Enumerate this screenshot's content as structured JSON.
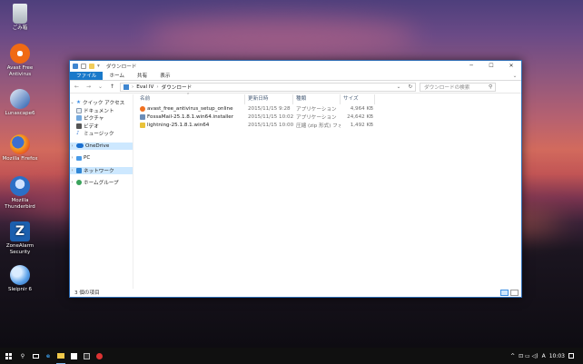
{
  "desktop": {
    "icons": [
      {
        "label": "ごみ箱",
        "icon": "recycle-bin-icon",
        "color": "#cfd6dd"
      },
      {
        "label": "Avast Free\nAntivirus",
        "icon": "avast-icon",
        "color": "#f06a14"
      },
      {
        "label": "Lunascape6",
        "icon": "lunascape-icon",
        "color": "#2a5fb0"
      },
      {
        "label": "Mozilla Firefox",
        "icon": "firefox-icon",
        "color": "#e5681f"
      },
      {
        "label": "Mozilla\nThunderbird",
        "icon": "thunderbird-icon",
        "color": "#2b6fc6"
      },
      {
        "label": "ZoneAlarm\nSecurity",
        "icon": "zonealarm-icon",
        "color": "#1b5fae"
      },
      {
        "label": "Sleipnir 6",
        "icon": "sleipnir-icon",
        "color": "#5aa0e8"
      }
    ]
  },
  "window": {
    "title": "ダウンロード",
    "controls": {
      "minimize": "─",
      "maximize": "☐",
      "close": "✕"
    },
    "ribbon": {
      "tabs": [
        "ファイル",
        "ホーム",
        "共有",
        "表示"
      ],
      "expand": "⌄"
    },
    "address": {
      "back": "←",
      "forward": "→",
      "recent": "⌄",
      "up": "↑",
      "path": [
        "Eval IV",
        "ダウンロード"
      ],
      "sep": "›",
      "dropdown": "⌄",
      "refresh": "↻"
    },
    "search": {
      "placeholder": "ダウンロードの検索",
      "icon": "⚲"
    },
    "nav": {
      "quick_access": "クイック アクセス",
      "quick_items": [
        "ドキュメント",
        "ピクチャ",
        "ビデオ",
        "ミュージック"
      ],
      "onedrive": "OneDrive",
      "pc": "PC",
      "network": "ネットワーク",
      "homegroup": "ホームグループ"
    },
    "columns": {
      "name": "名前",
      "date": "更新日時",
      "type": "種類",
      "size": "サイズ"
    },
    "files": [
      {
        "name": "avast_free_antivirus_setup_online",
        "date": "2015/11/15 9:28",
        "type": "アプリケーション",
        "size": "4,964 KB",
        "icon_color": "#f07020"
      },
      {
        "name": "FossaMail-25.1.8.1.win64.installer",
        "date": "2015/11/15 10:02",
        "type": "アプリケーション",
        "size": "24,642 KB",
        "icon_color": "#6b8db8"
      },
      {
        "name": "lightning-25.1.8.1.win64",
        "date": "2015/11/15 10:00",
        "type": "圧縮 (zip 形式) フォ...",
        "size": "1,492 KB",
        "icon_color": "#e9c23a"
      }
    ],
    "status": "3 個の項目"
  },
  "taskbar": {
    "tray_ime": "A",
    "time": "10:03",
    "tray_caret": "^",
    "tray_icons": "⊡ ▭ ◁)"
  }
}
